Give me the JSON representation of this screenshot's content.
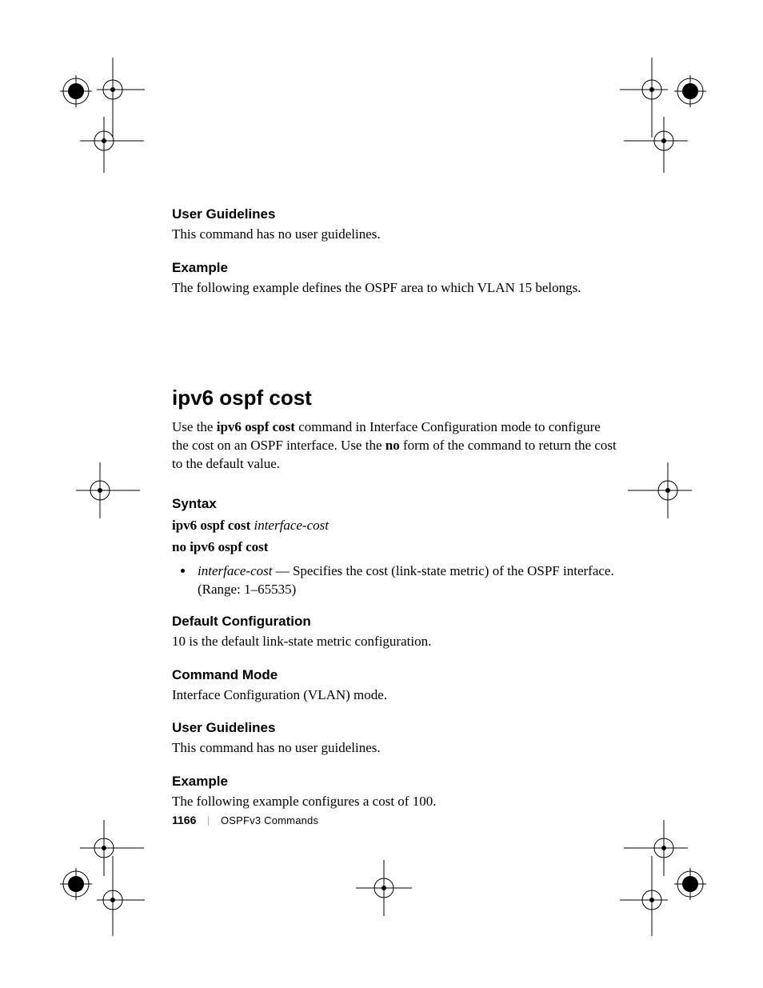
{
  "sections": {
    "userGuidelines1": {
      "heading": "User Guidelines",
      "body": "This command has no user guidelines."
    },
    "example1": {
      "heading": "Example",
      "body": "The following example defines the OSPF area to which VLAN 15 belongs."
    },
    "command": {
      "heading": "ipv6 ospf cost",
      "intro_pre": "Use the ",
      "intro_cmd": "ipv6 ospf cost",
      "intro_mid": " command in Interface Configuration mode to configure the cost on an OSPF interface. Use the ",
      "intro_no": "no",
      "intro_post": " form of the command to return the cost to the default value."
    },
    "syntax": {
      "heading": "Syntax",
      "line1_cmd": "ipv6 ospf cost ",
      "line1_arg": "interface-cost",
      "line2": "no ipv6 ospf cost",
      "bullet_arg": "interface-cost",
      "bullet_dash": " — ",
      "bullet_text": "Specifies the cost (link-state metric) of the OSPF interface. (Range: 1–65535)"
    },
    "defaultConfig": {
      "heading": "Default Configuration",
      "body": "10 is the default link-state metric configuration."
    },
    "commandMode": {
      "heading": "Command Mode",
      "body": "Interface Configuration (VLAN) mode."
    },
    "userGuidelines2": {
      "heading": "User Guidelines",
      "body": "This command has no user guidelines."
    },
    "example2": {
      "heading": "Example",
      "body": "The following example configures a cost of 100."
    }
  },
  "footer": {
    "pageNumber": "1166",
    "divider": "|",
    "sectionName": "OSPFv3 Commands"
  }
}
